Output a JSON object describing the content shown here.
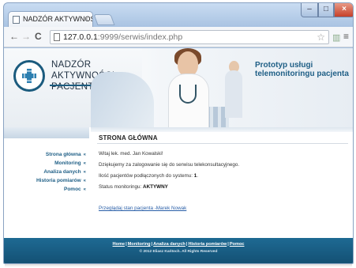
{
  "browser": {
    "tab_title": "NADZÓR AKTYWNOŚ",
    "tab_close": "×",
    "url_host": "127.0.0.1",
    "url_path": ":9999/serwis/index.php",
    "back_icon": "←",
    "forward_icon": "→",
    "reload_icon": "C",
    "star_icon": "☆",
    "menu_icon": "≡",
    "min_label": "–",
    "max_label": "□",
    "close_label": "×"
  },
  "header": {
    "logo_line1": "NADZÓR AKTYWNOŚCI",
    "logo_line2": "PACJENTA",
    "tagline_line1": "Prototyp usługi",
    "tagline_line2": "telemonitoringu pacjenta"
  },
  "sidebar": {
    "arrow": "«",
    "items": [
      {
        "label": "Strona główna"
      },
      {
        "label": "Monitoring"
      },
      {
        "label": "Analiza danych"
      },
      {
        "label": "Historia pomiarów"
      },
      {
        "label": "Pomoc"
      }
    ]
  },
  "main": {
    "title": "STRONA GŁÓWNA",
    "welcome": "Witaj lek. med. Jan Kowalski!",
    "thanks": "Dziękujemy za zalogowanie się do serwisu telekonsultacyjnego.",
    "patients_label": "Ilość pacjentów podłączonych do systemu: ",
    "patients_count": "1",
    "patients_suffix": ".",
    "status_label": "Status monitoringu: ",
    "status_value": "AKTYWNY",
    "patient_link": "Przeglądaj stan pacjenta -Marek Nowak"
  },
  "footer": {
    "links": [
      "Home",
      "Monitoring",
      "Analiza danych",
      "Historia pomiarów",
      "Pomoc"
    ],
    "separator": "|",
    "copyright": "© 2012 Eliasz Kańtoch. All Rights Reserved"
  },
  "colors": {
    "brand_blue": "#1f5f86",
    "footer_blue": "#1e6a93",
    "link_blue": "#2a5fa8"
  }
}
